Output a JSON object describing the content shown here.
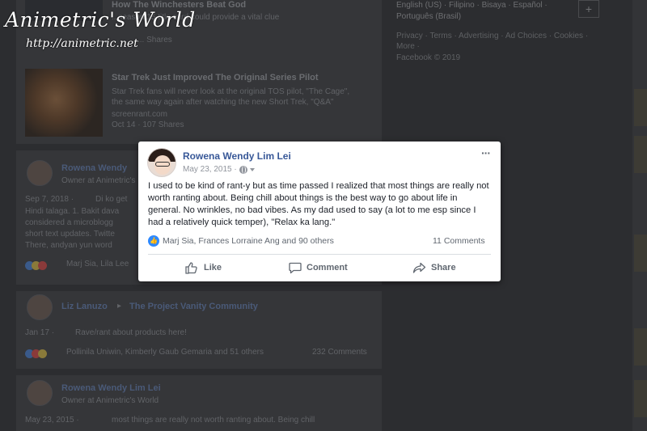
{
  "watermark": {
    "title": "Animetric's World",
    "url": "http://animetric.net"
  },
  "right_column": {
    "languages": "English (US) · Filipino · Bisaya · Español · Português (Brasil)",
    "plus_label": "+",
    "links": "Privacy · Terms · Advertising · Ad Choices · Cookies · More ·",
    "copyright": "Facebook © 2019"
  },
  "background_feed": {
    "article1": {
      "title": "How The Winchesters Beat God",
      "snippet": "...season 15 title card could provide a vital clue",
      "shares": "... Shares"
    },
    "article2": {
      "title": "Star Trek Just Improved The Original Series Pilot",
      "snippet1": "Star Trek fans will never look at the original TOS pilot, \"The Cage\",",
      "snippet2": "the same way again after watching the new Short Trek, \"Q&A\"",
      "source": "screenrant.com",
      "date": "Oct 14 · 107 Shares"
    },
    "post1": {
      "author": "Rowena Wendy",
      "subtitle": "Owner at Animetric's",
      "date": "Sep 7, 2018 ·",
      "line1": "Di ko get",
      "line2": "Hindi talaga. 1. Bakit dava",
      "line3": "considered a microblogg",
      "line4": "short text updates. Twitte",
      "line5": "There, andyan yun word",
      "reactors": "Marj Sia, Lila Lee"
    },
    "post2": {
      "author": "Liz Lanuzo",
      "group": "The Project Vanity Community",
      "date": "Jan 17 ·",
      "text": "Rave/rant about products here!",
      "reactors": "Pollinila Uniwin, Kimberly Gaub Gemaria and 51 others",
      "comments": "232 Comments"
    },
    "post3": {
      "author": "Rowena Wendy Lim Lei",
      "subtitle": "Owner at Animetric's World",
      "date": "May 23, 2015 ·",
      "text": "most things are really not worth ranting about. Being chill"
    }
  },
  "post": {
    "author": "Rowena Wendy Lim Lei",
    "date": "May 23, 2015 ·",
    "privacy_icon": "globe-icon",
    "more_label": "···",
    "body": "I used to be kind of rant-y but as time passed I realized that most things are really not worth ranting about. Being chill about things is the best way to go about life in general. No wrinkles, no bad vibes. As my dad used to say (a lot to me esp since I had a relatively quick temper), \"Relax ka lang.\"",
    "reactions": "Marj Sia, Frances Lorraine Ang and 90 others",
    "comments": "11 Comments",
    "actions": {
      "like": "Like",
      "comment": "Comment",
      "share": "Share"
    }
  },
  "colors": {
    "name_link": "#385898",
    "like_blue": "#2e89ff",
    "overlay": "#2c2d30"
  }
}
